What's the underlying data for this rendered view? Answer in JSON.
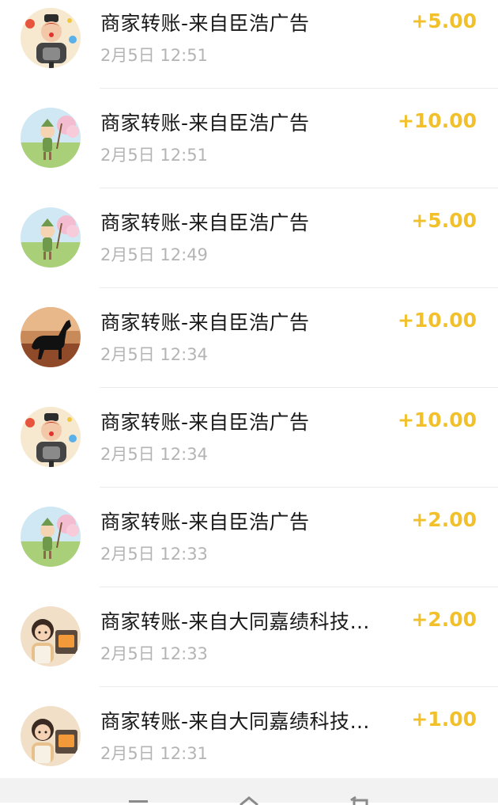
{
  "transactions": [
    {
      "title": "商家转账-来自臣浩广告",
      "time": "2月5日 12:51",
      "amount": "+5.00",
      "avatar": "clown-avatar-icon"
    },
    {
      "title": "商家转账-来自臣浩广告",
      "time": "2月5日 12:51",
      "amount": "+10.00",
      "avatar": "fairy-avatar-icon"
    },
    {
      "title": "商家转账-来自臣浩广告",
      "time": "2月5日 12:49",
      "amount": "+5.00",
      "avatar": "fairy-avatar-icon"
    },
    {
      "title": "商家转账-来自臣浩广告",
      "time": "2月5日 12:34",
      "amount": "+10.00",
      "avatar": "horse-avatar-icon"
    },
    {
      "title": "商家转账-来自臣浩广告",
      "time": "2月5日 12:34",
      "amount": "+10.00",
      "avatar": "clown-avatar-icon"
    },
    {
      "title": "商家转账-来自臣浩广告",
      "time": "2月5日 12:33",
      "amount": "+2.00",
      "avatar": "fairy-avatar-icon"
    },
    {
      "title": "商家转账-来自大同嘉绩科技…",
      "time": "2月5日 12:33",
      "amount": "+2.00",
      "avatar": "girl-oven-avatar-icon"
    },
    {
      "title": "商家转账-来自大同嘉绩科技…",
      "time": "2月5日 12:31",
      "amount": "+1.00",
      "avatar": "girl-oven-avatar-icon"
    }
  ],
  "colors": {
    "amount": "#f2c02b",
    "title": "#1a1a1a",
    "time": "#b4b4b4"
  },
  "navbar": {
    "icons": [
      "menu-icon",
      "home-icon",
      "back-icon"
    ]
  }
}
